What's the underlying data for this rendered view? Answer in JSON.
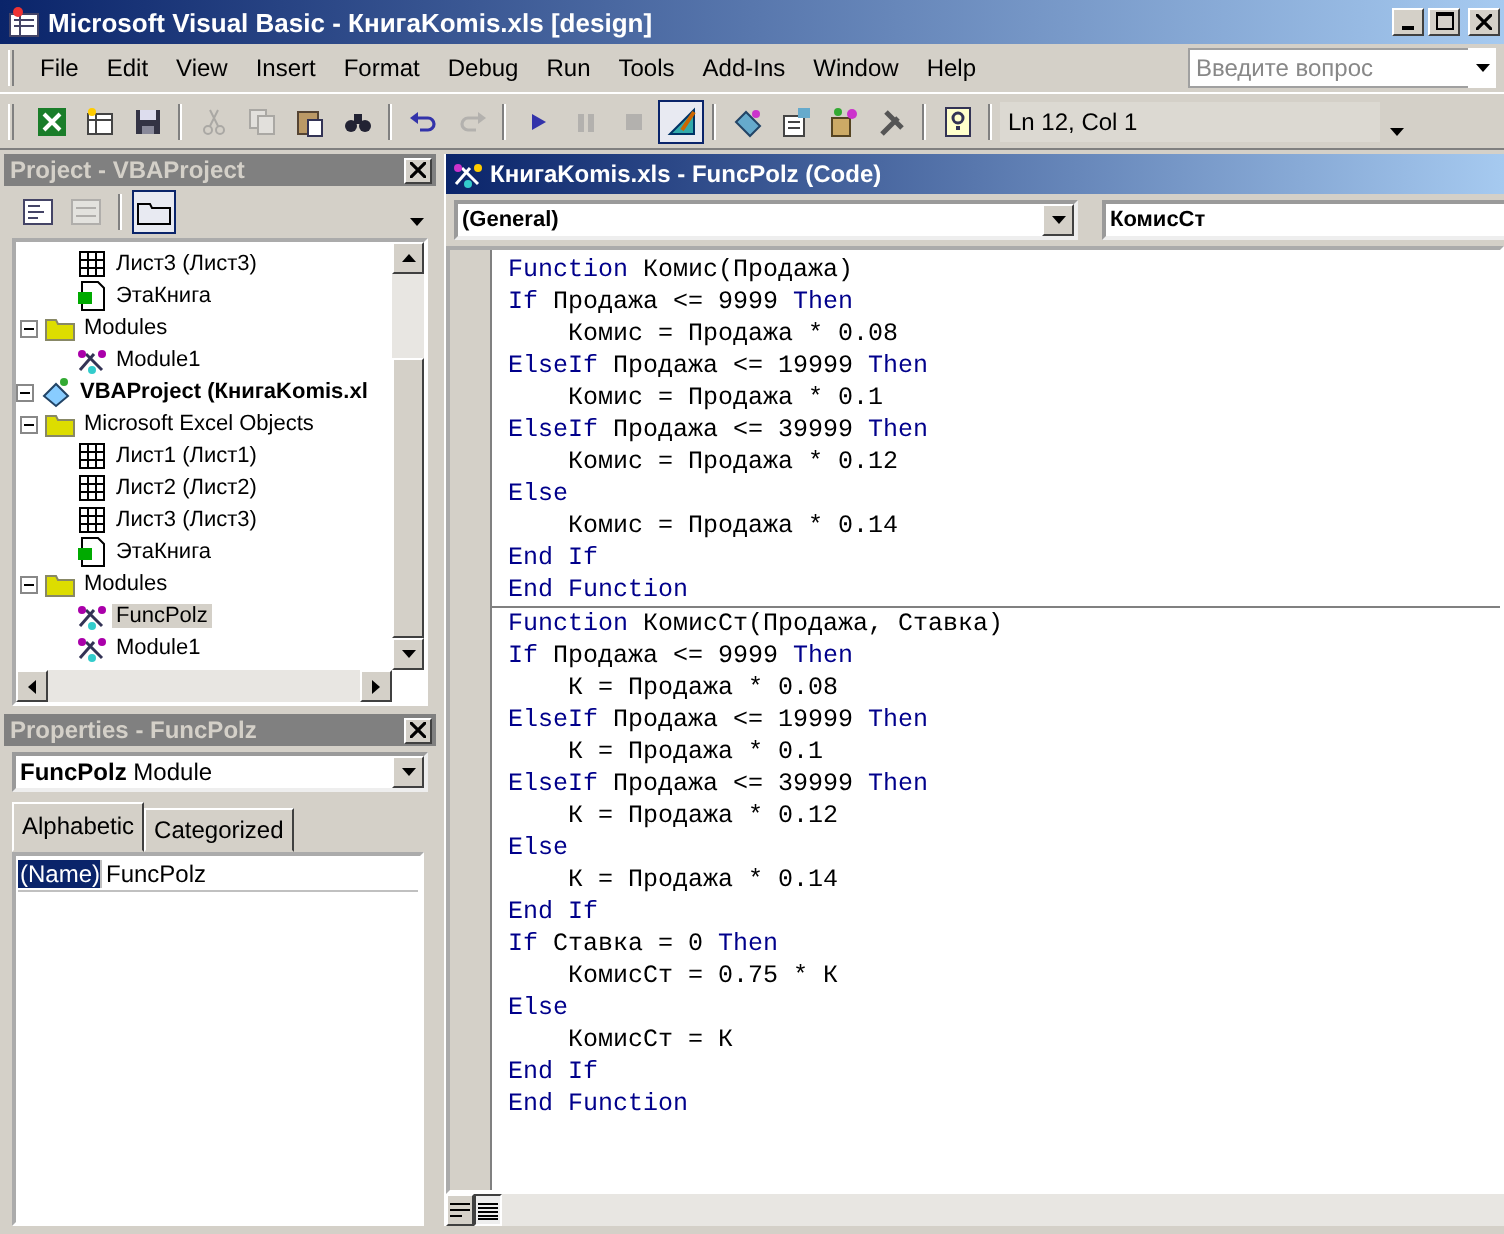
{
  "window": {
    "title": "Microsoft Visual Basic - КнигаKomis.xls [design]"
  },
  "menu": [
    "File",
    "Edit",
    "View",
    "Insert",
    "Format",
    "Debug",
    "Run",
    "Tools",
    "Add-Ins",
    "Window",
    "Help"
  ],
  "help_search": {
    "placeholder": "Введите вопрос"
  },
  "toolbar": [
    {
      "kind": "excel",
      "disabled": false,
      "on": false
    },
    {
      "kind": "insert",
      "disabled": false,
      "on": false
    },
    {
      "kind": "save",
      "disabled": false,
      "on": false
    },
    {
      "kind": "sep"
    },
    {
      "kind": "cut",
      "disabled": true,
      "on": false
    },
    {
      "kind": "copy",
      "disabled": true,
      "on": false
    },
    {
      "kind": "paste",
      "disabled": false,
      "on": false
    },
    {
      "kind": "find",
      "disabled": false,
      "on": false
    },
    {
      "kind": "sep"
    },
    {
      "kind": "undo",
      "disabled": false,
      "on": false
    },
    {
      "kind": "redo",
      "disabled": true,
      "on": false
    },
    {
      "kind": "sep"
    },
    {
      "kind": "run",
      "disabled": false,
      "on": false
    },
    {
      "kind": "pause",
      "disabled": true,
      "on": false
    },
    {
      "kind": "stop",
      "disabled": true,
      "on": false
    },
    {
      "kind": "design",
      "disabled": false,
      "on": true
    },
    {
      "kind": "sep"
    },
    {
      "kind": "project",
      "disabled": false,
      "on": false
    },
    {
      "kind": "properties",
      "disabled": false,
      "on": false
    },
    {
      "kind": "objects",
      "disabled": false,
      "on": false
    },
    {
      "kind": "tools",
      "disabled": false,
      "on": false
    },
    {
      "kind": "sep"
    },
    {
      "kind": "help",
      "disabled": false,
      "on": false
    }
  ],
  "cursor_position": "Ln 12, Col 1",
  "project": {
    "title": "Project - VBAProject",
    "folders_toggle": {
      "on": true
    },
    "tree": [
      {
        "children": [
          {
            "children": [
              {
                "kind": "sheet",
                "label": "Лист3 (Лист3)",
                "selected": false
              },
              {
                "kind": "workbook",
                "label": "ЭтаКнига",
                "selected": false
              }
            ]
          },
          {
            "kind": "folder",
            "label": "Modules",
            "expanded": true,
            "children": [
              {
                "kind": "module",
                "label": "Module1",
                "selected": false
              }
            ]
          }
        ]
      },
      {
        "kind": "project",
        "label": "VBAProject (КнигаKomis.xl",
        "expanded": true,
        "children": [
          {
            "kind": "folder",
            "label": "Microsoft Excel Objects",
            "expanded": true,
            "children": [
              {
                "kind": "sheet",
                "label": "Лист1 (Лист1)",
                "selected": false
              },
              {
                "kind": "sheet",
                "label": "Лист2 (Лист2)",
                "selected": false
              },
              {
                "kind": "sheet",
                "label": "Лист3 (Лист3)",
                "selected": false
              },
              {
                "kind": "workbook",
                "label": "ЭтаКнига",
                "selected": false
              }
            ]
          },
          {
            "kind": "folder",
            "label": "Modules",
            "expanded": true,
            "children": [
              {
                "kind": "module",
                "label": "FuncPolz",
                "selected": true
              },
              {
                "kind": "module",
                "label": "Module1",
                "selected": false
              }
            ]
          }
        ]
      }
    ]
  },
  "properties": {
    "title": "Properties - FuncPolz",
    "object": "**FuncPolz** Module",
    "tabs": [
      {
        "label": "Alphabetic",
        "selected": true
      },
      {
        "label": "Categorized",
        "selected": false
      }
    ],
    "rows": [
      {
        "name": "(Name)",
        "value": "FuncPolz",
        "selected": true
      }
    ]
  },
  "code_window": {
    "title": "КнигаKomis.xls - FuncPolz (Code)",
    "object": "(General)",
    "procedure": "КомисСт",
    "procedures": [
      {
        "lines": [
          [
            {
              "text": "Function",
              "keyword": true
            },
            {
              "text": " Комис(Продажа)",
              "keyword": false
            }
          ],
          [
            {
              "text": "If",
              "keyword": true
            },
            {
              "text": " Продажа <= 9999 ",
              "keyword": false
            },
            {
              "text": "Then",
              "keyword": true
            }
          ],
          [
            {
              "text": "    Комис = Продажа * 0.08",
              "keyword": false
            }
          ],
          [
            {
              "text": "ElseIf",
              "keyword": true
            },
            {
              "text": " Продажа <= 19999 ",
              "keyword": false
            },
            {
              "text": "Then",
              "keyword": true
            }
          ],
          [
            {
              "text": "    Комис = Продажа * 0.1",
              "keyword": false
            }
          ],
          [
            {
              "text": "ElseIf",
              "keyword": true
            },
            {
              "text": " Продажа <= 39999 ",
              "keyword": false
            },
            {
              "text": "Then",
              "keyword": true
            }
          ],
          [
            {
              "text": "    Комис = Продажа * 0.12",
              "keyword": false
            }
          ],
          [
            {
              "text": "Else",
              "keyword": true
            }
          ],
          [
            {
              "text": "    Комис = Продажа * 0.14",
              "keyword": false
            }
          ],
          [
            {
              "text": "End If",
              "keyword": true
            }
          ],
          [
            {
              "text": "End Function",
              "keyword": true
            }
          ]
        ]
      },
      {
        "lines": [
          [
            {
              "text": "Function",
              "keyword": true
            },
            {
              "text": " КомисСт(Продажа, Ставка)",
              "keyword": false
            }
          ],
          [
            {
              "text": "If",
              "keyword": true
            },
            {
              "text": " Продажа <= 9999 ",
              "keyword": false
            },
            {
              "text": "Then",
              "keyword": true
            }
          ],
          [
            {
              "text": "    К = Продажа * 0.08",
              "keyword": false
            }
          ],
          [
            {
              "text": "ElseIf",
              "keyword": true
            },
            {
              "text": " Продажа <= 19999 ",
              "keyword": false
            },
            {
              "text": "Then",
              "keyword": true
            }
          ],
          [
            {
              "text": "    К = Продажа * 0.1",
              "keyword": false
            }
          ],
          [
            {
              "text": "ElseIf",
              "keyword": true
            },
            {
              "text": " Продажа <= 39999 ",
              "keyword": false
            },
            {
              "text": "Then",
              "keyword": true
            }
          ],
          [
            {
              "text": "    К = Продажа * 0.12",
              "keyword": false
            }
          ],
          [
            {
              "text": "Else",
              "keyword": true
            }
          ],
          [
            {
              "text": "    К = Продажа * 0.14",
              "keyword": false
            }
          ],
          [
            {
              "text": "End If",
              "keyword": true
            }
          ],
          [
            {
              "text": "If",
              "keyword": true
            },
            {
              "text": " Ставка = 0 ",
              "keyword": false
            },
            {
              "text": "Then",
              "keyword": true
            }
          ],
          [
            {
              "text": "    КомисСт = 0.75 * К",
              "keyword": false
            }
          ],
          [
            {
              "text": "Else",
              "keyword": true
            }
          ],
          [
            {
              "text": "    КомисСт = К",
              "keyword": false
            }
          ],
          [
            {
              "text": "End If",
              "keyword": true
            }
          ],
          [
            {
              "text": "End Function",
              "keyword": true
            }
          ]
        ]
      }
    ],
    "view_buttons": [
      {
        "kind": "procedure",
        "selected": false
      },
      {
        "kind": "module",
        "selected": true
      }
    ]
  }
}
